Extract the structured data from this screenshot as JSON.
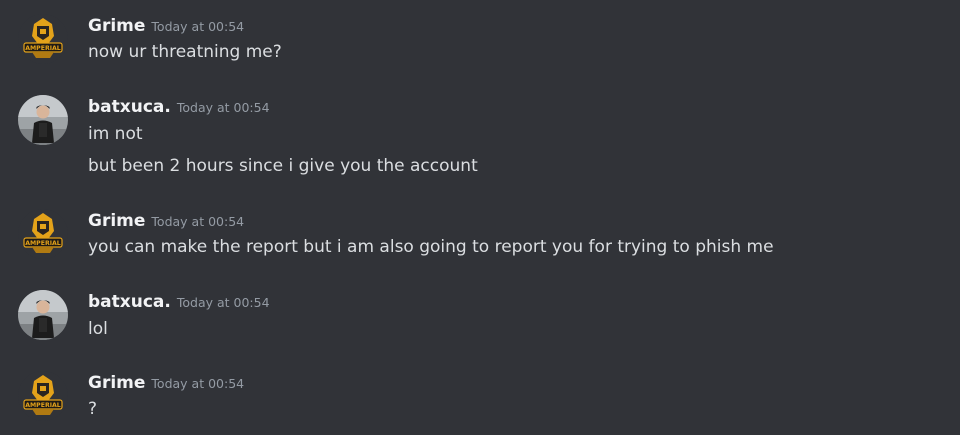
{
  "messages": [
    {
      "author": "Grime",
      "timestamp": "Today at 00:54",
      "lines": [
        "now ur threatning me?"
      ]
    },
    {
      "author": "batxuca.",
      "timestamp": "Today at 00:54",
      "lines": [
        "im not",
        "but been 2 hours since i give you the account"
      ]
    },
    {
      "author": "Grime",
      "timestamp": "Today at 00:54",
      "lines": [
        "you can make the report but i am also going to report you for trying to phish me"
      ]
    },
    {
      "author": "batxuca.",
      "timestamp": "Today at 00:54",
      "lines": [
        "lol"
      ]
    },
    {
      "author": "Grime",
      "timestamp": "Today at 00:54",
      "lines": [
        "?"
      ]
    }
  ],
  "avatars": {
    "grime_logo_text": "AMPERIAL"
  },
  "colors": {
    "background": "#313338",
    "username": "#f2f3f5",
    "timestamp": "#949ba4",
    "message_text": "#dbdee1",
    "grime_accent": "#e3a21a"
  }
}
